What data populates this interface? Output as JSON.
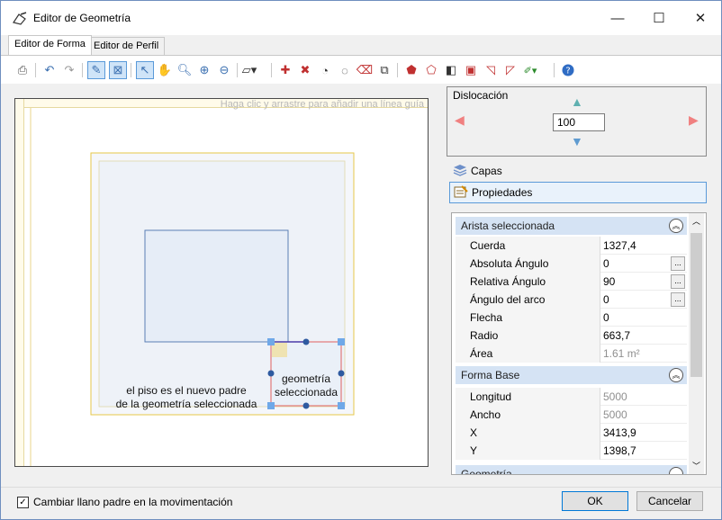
{
  "window": {
    "title": "Editor de Geometría"
  },
  "window_controls": {
    "minimize": "—",
    "maximize": "☐",
    "close": "✕"
  },
  "tabs": [
    {
      "label": "Editor de Forma"
    },
    {
      "label": "Editor de Perfil"
    }
  ],
  "canvas": {
    "guide_hint": "Haga clic y arrastre para añadir una línea guía",
    "annotation_parent": [
      "el piso es el nuevo padre",
      "de la geometría seleccionada"
    ],
    "annotation_selected": [
      "geometría",
      "seleccionada"
    ]
  },
  "dislocation": {
    "title": "Dislocación",
    "value": "100"
  },
  "side_buttons": {
    "layers": "Capas",
    "properties": "Propiedades"
  },
  "properties": {
    "sections": [
      {
        "title": "Arista seleccionada",
        "rows": [
          {
            "key": "Cuerda",
            "value": "1327,4",
            "readonly": false,
            "ellipsis": false
          },
          {
            "key": "Absoluta Ángulo",
            "value": "0",
            "readonly": false,
            "ellipsis": true
          },
          {
            "key": "Relativa Ángulo",
            "value": "90",
            "readonly": false,
            "ellipsis": true
          },
          {
            "key": "Ángulo del arco",
            "value": "0",
            "readonly": false,
            "ellipsis": true
          },
          {
            "key": "Flecha",
            "value": "0",
            "readonly": false,
            "ellipsis": false
          },
          {
            "key": "Radio",
            "value": "663,7",
            "readonly": false,
            "ellipsis": false
          },
          {
            "key": "Área",
            "value": "1.61 m²",
            "readonly": true,
            "ellipsis": false
          }
        ]
      },
      {
        "title": "Forma Base",
        "rows": [
          {
            "key": "Longitud",
            "value": "5000",
            "readonly": true,
            "ellipsis": false
          },
          {
            "key": "Ancho",
            "value": "5000",
            "readonly": true,
            "ellipsis": false
          },
          {
            "key": "X",
            "value": "3413,9",
            "readonly": false,
            "ellipsis": false
          },
          {
            "key": "Y",
            "value": "1398,7",
            "readonly": false,
            "ellipsis": false
          }
        ]
      },
      {
        "title": "Geometría",
        "rows": []
      }
    ]
  },
  "footer": {
    "checkbox_label": "Cambiar llano padre en la movimentación",
    "ok": "OK",
    "cancel": "Cancelar"
  }
}
